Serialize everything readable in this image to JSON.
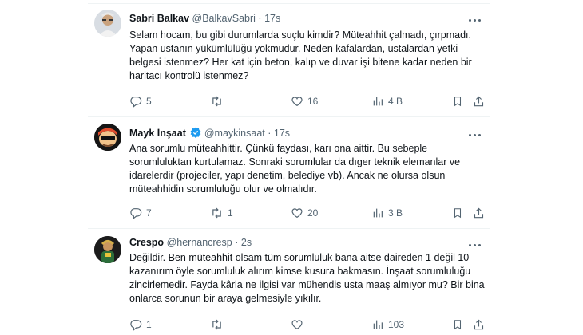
{
  "tweets": [
    {
      "name": "Sabri Balkav",
      "handle": "@BalkavSabri",
      "dot": "·",
      "time": "17s",
      "text": "Selam hocam, bu gibi durumlarda suçlu kimdir? Müteahhit çalmadı, çırpmadı.  Yapan ustanın yükümlülüğü yokmudur. Neden kafalardan, ustalardan yetki belgesi istenmez?  Her kat için beton, kalıp ve duvar işi bitene kadar neden bir haritacı kontrolü istenmez?",
      "replies": "5",
      "retweets": "",
      "likes": "16",
      "views": "4 B",
      "verified": false
    },
    {
      "name": "Mayk İnşaat",
      "handle": "@maykinsaat",
      "dot": "·",
      "time": "17s",
      "text": "Ana sorumlu müteahhittir. Çünkü faydası, karı ona aittir. Bu sebeple sorumluluktan kurtulamaz. Sonraki sorumlular da dıger teknik elemanlar ve idarelerdir (projeciler, yapı denetim, belediye vb). Ancak ne olursa olsun müteahhidin sorumluluğu olur ve olmalıdır.",
      "replies": "7",
      "retweets": "1",
      "likes": "20",
      "views": "3 B",
      "verified": true
    },
    {
      "name": "Crespo",
      "handle": "@hernancresp",
      "dot": "·",
      "time": "2s",
      "text": "Değildir. Ben müteahhit olsam tüm sorumluluk bana aitse daireden 1 değil 10 kazanırım öyle sorumluluk alırım kimse kusura bakmasın. İnşaat sorumluluğu zincirlemedir. Fayda kârla ne ilgisi var mühendis usta maaş almıyor mu? Bir bina onlarca sorunun bir araya gelmesiyle yıkılır.",
      "replies": "1",
      "retweets": "",
      "likes": "",
      "views": "103",
      "verified": false
    }
  ],
  "icons": {
    "reply": "reply-icon",
    "retweet": "retweet-icon",
    "like": "heart-icon",
    "views": "views-chart-icon",
    "bookmark": "bookmark-icon",
    "share": "share-icon",
    "more": "more-icon",
    "verified": "verified-badge-icon"
  },
  "colors": {
    "text": "#0f1419",
    "muted": "#536471",
    "verified": "#1d9bf0",
    "divider": "#eff3f4"
  }
}
